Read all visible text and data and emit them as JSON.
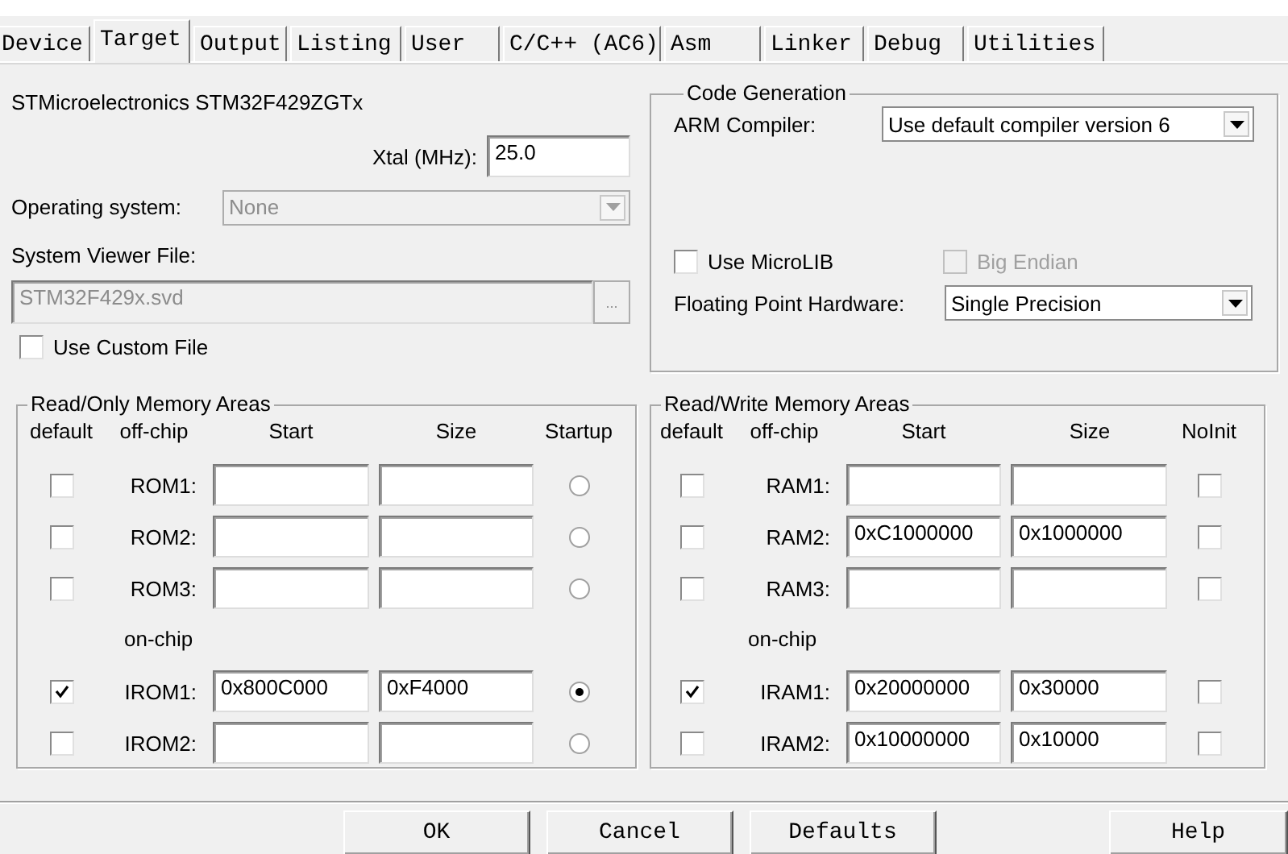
{
  "tabs": [
    {
      "label": "Device",
      "selected": false
    },
    {
      "label": "Target",
      "selected": true
    },
    {
      "label": "Output",
      "selected": false
    },
    {
      "label": "Listing",
      "selected": false
    },
    {
      "label": "User",
      "selected": false
    },
    {
      "label": "C/C++ (AC6)",
      "selected": false
    },
    {
      "label": "Asm",
      "selected": false
    },
    {
      "label": "Linker",
      "selected": false
    },
    {
      "label": "Debug",
      "selected": false
    },
    {
      "label": "Utilities",
      "selected": false
    }
  ],
  "target": {
    "device": "STMicroelectronics STM32F429ZGTx",
    "xtal": {
      "label": "Xtal (MHz):",
      "value": "25.0"
    },
    "operating_system": {
      "label": "Operating system:",
      "value": "None",
      "disabled": true
    },
    "system_viewer_file": {
      "label": "System Viewer File:",
      "value": "STM32F429x.svd",
      "disabled": true,
      "browse": "..."
    },
    "custom_file": {
      "label": "Use Custom File",
      "checked": false
    }
  },
  "code_generation": {
    "title": "Code Generation",
    "compiler": {
      "label": "ARM Compiler:",
      "value": "Use default compiler version 6"
    },
    "microlib": {
      "label": "Use MicroLIB",
      "checked": false,
      "disabled": false
    },
    "big_endian": {
      "label": "Big Endian",
      "checked": false,
      "disabled": true
    },
    "fpu": {
      "label": "Floating Point Hardware:",
      "value": "Single Precision"
    }
  },
  "rom": {
    "title": "Read/Only Memory Areas",
    "columns": [
      "default",
      "off-chip",
      "Start",
      "Size",
      "Startup"
    ],
    "on_chip_label": "on-chip",
    "off_chip_rows": [
      {
        "label": "ROM1:",
        "default": false,
        "start": "",
        "size": "",
        "selected": false
      },
      {
        "label": "ROM2:",
        "default": false,
        "start": "",
        "size": "",
        "selected": false
      },
      {
        "label": "ROM3:",
        "default": false,
        "start": "",
        "size": "",
        "selected": false
      }
    ],
    "on_chip_rows": [
      {
        "label": "IROM1:",
        "default": true,
        "start": "0x800C000",
        "size": "0xF4000",
        "selected": true
      },
      {
        "label": "IROM2:",
        "default": false,
        "start": "",
        "size": "",
        "selected": false
      }
    ]
  },
  "ram": {
    "title": "Read/Write Memory Areas",
    "columns": [
      "default",
      "off-chip",
      "Start",
      "Size",
      "NoInit"
    ],
    "on_chip_label": "on-chip",
    "off_chip_rows": [
      {
        "label": "RAM1:",
        "default": false,
        "start": "",
        "size": "",
        "noinit": false
      },
      {
        "label": "RAM2:",
        "default": false,
        "start": "0xC1000000",
        "size": "0x1000000",
        "noinit": false
      },
      {
        "label": "RAM3:",
        "default": false,
        "start": "",
        "size": "",
        "noinit": false
      }
    ],
    "on_chip_rows": [
      {
        "label": "IRAM1:",
        "default": true,
        "start": "0x20000000",
        "size": "0x30000",
        "noinit": false
      },
      {
        "label": "IRAM2:",
        "default": false,
        "start": "0x10000000",
        "size": "0x10000",
        "noinit": false
      }
    ]
  },
  "buttons": [
    {
      "label": "OK",
      "kind": "ok"
    },
    {
      "label": "Cancel",
      "kind": "cancel"
    },
    {
      "label": "Defaults",
      "kind": "defaults"
    },
    {
      "label": "Help",
      "kind": "help"
    }
  ]
}
